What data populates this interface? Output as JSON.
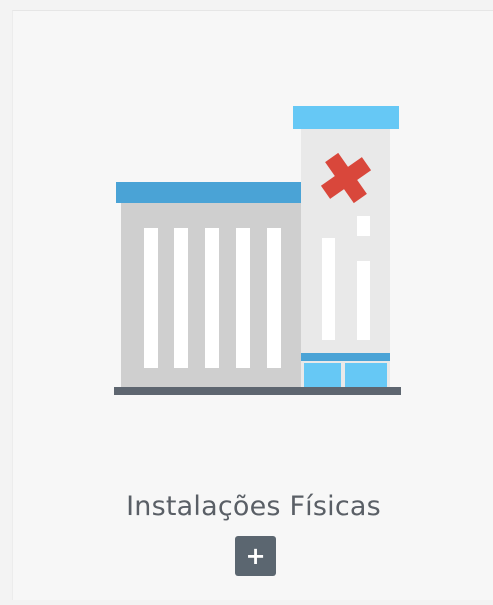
{
  "card": {
    "title": "Instalações Físicas",
    "add_button_label": "+",
    "icon": "hospital-building-icon"
  },
  "colors": {
    "card_background": "#f7f7f7",
    "page_background": "#f3f3f3",
    "title_text": "#5a5f66",
    "button_background": "#5b6670",
    "roof_blue": "#4aa3d6",
    "light_blue": "#66c8f5",
    "building_gray": "#cfcfcf",
    "tower_light": "#e9e9e9",
    "cross_red": "#d9473b",
    "ground": "#5e6670"
  }
}
